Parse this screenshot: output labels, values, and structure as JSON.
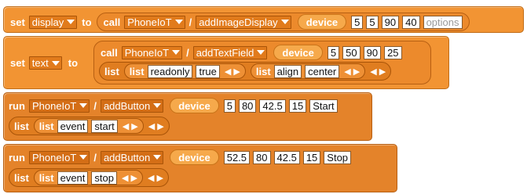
{
  "blocks": {
    "set_display": {
      "set": "set",
      "var": "display",
      "to": "to",
      "call": "call",
      "service": "PhoneIoT",
      "slash": "/",
      "rpc": "addImageDisplay",
      "device": "device",
      "args": [
        "5",
        "5",
        "90",
        "40"
      ],
      "options_placeholder": "options"
    },
    "set_text": {
      "set": "set",
      "var": "text",
      "to": "to",
      "call": "call",
      "service": "PhoneIoT",
      "slash": "/",
      "rpc": "addTextField",
      "device": "device",
      "args": [
        "5",
        "50",
        "90",
        "25"
      ],
      "list": "list",
      "pairs": [
        {
          "key": "readonly",
          "value": "true"
        },
        {
          "key": "align",
          "value": "center"
        }
      ]
    },
    "run_start": {
      "run": "run",
      "service": "PhoneIoT",
      "slash": "/",
      "rpc": "addButton",
      "device": "device",
      "args": [
        "5",
        "80",
        "42.5",
        "15",
        "Start"
      ],
      "list": "list",
      "pair": {
        "key": "event",
        "value": "start"
      }
    },
    "run_stop": {
      "run": "run",
      "service": "PhoneIoT",
      "slash": "/",
      "rpc": "addButton",
      "device": "device",
      "args": [
        "52.5",
        "80",
        "42.5",
        "15",
        "Stop"
      ],
      "list": "list",
      "pair": {
        "key": "event",
        "value": "stop"
      }
    }
  },
  "glyphs": {
    "arrows": "◀ ▶",
    "dropdown": "▼"
  },
  "colors": {
    "block": "#e4832a",
    "set_block": "#f29433",
    "device_pill": "#f6a94b",
    "slot": "#ffffff"
  }
}
